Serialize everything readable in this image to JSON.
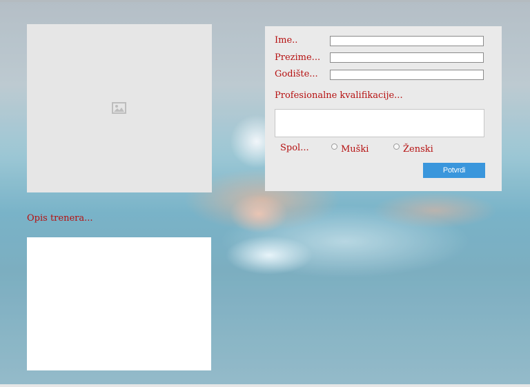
{
  "trainer_description": {
    "label": "Opis trenera..."
  },
  "form": {
    "first_name": {
      "label": "Ime..",
      "value": ""
    },
    "last_name": {
      "label": "Prezime...",
      "value": ""
    },
    "birth_year": {
      "label": "Godište...",
      "value": ""
    },
    "qualifications": {
      "label": "Profesionalne kvalifikacije...",
      "value": ""
    },
    "gender": {
      "label": "Spol...",
      "options": [
        "Muški",
        "Ženski"
      ]
    },
    "submit_label": "Potvrdi"
  },
  "colors": {
    "label": "#b50f0f",
    "button": "#3a96dc",
    "panel": "#eaeaea"
  }
}
